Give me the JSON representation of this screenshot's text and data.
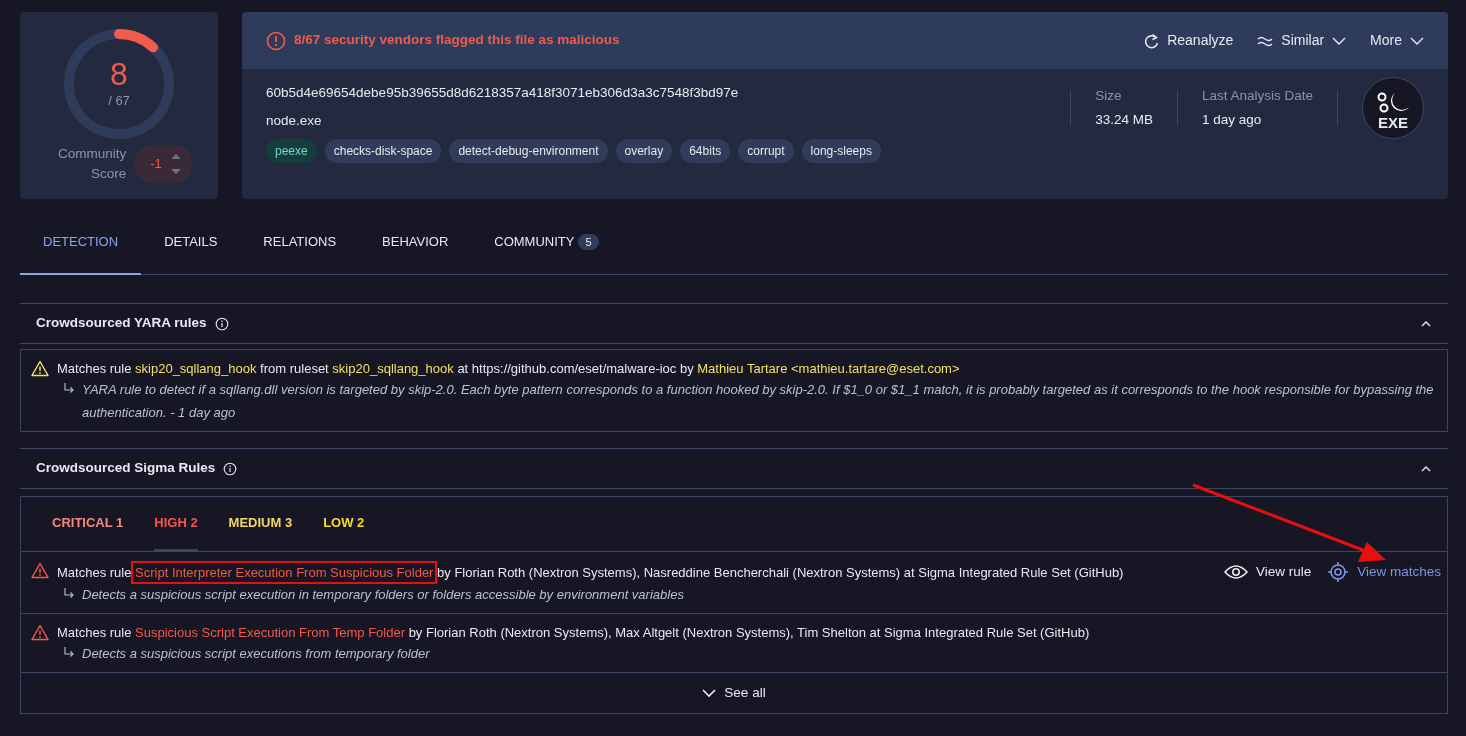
{
  "score": {
    "detections": "8",
    "total": "/ 67",
    "level": 0.119,
    "community_label": "Community Score",
    "community_value": "-1"
  },
  "alert": "8/67 security vendors flagged this file as malicious",
  "actions": [
    {
      "label": "Reanalyze",
      "kind": "reload"
    },
    {
      "label": "Similar",
      "kind": "similar"
    },
    {
      "label": "More",
      "kind": "more"
    }
  ],
  "file": {
    "hash": "60b5d4e69654debe95b39655d8d6218357a418f3071eb306d3a3c7548f3bd97e",
    "name": "node.exe",
    "tags": [
      {
        "label": "peexe",
        "selected": true
      },
      {
        "label": "checks-disk-space",
        "selected": false
      },
      {
        "label": "detect-debug-environment",
        "selected": false
      },
      {
        "label": "overlay",
        "selected": false
      },
      {
        "label": "64bits",
        "selected": false
      },
      {
        "label": "corrupt",
        "selected": false
      },
      {
        "label": "long-sleeps",
        "selected": false
      }
    ],
    "stats": [
      {
        "label": "Size",
        "value": "33.24 MB"
      },
      {
        "label": "Last Analysis Date",
        "value": "1 day ago"
      }
    ],
    "type_badge": "EXE"
  },
  "tabs": [
    {
      "label": "DETECTION",
      "selected": true
    },
    {
      "label": "DETAILS",
      "selected": false
    },
    {
      "label": "RELATIONS",
      "selected": false
    },
    {
      "label": "BEHAVIOR",
      "selected": false
    },
    {
      "label": "COMMUNITY",
      "selected": false,
      "count": "5"
    }
  ],
  "yara": {
    "title": "Crowdsourced YARA rules",
    "expanded": true,
    "matches": [
      {
        "kind": "warning",
        "parts": [
          {
            "text": "Matches rule "
          },
          {
            "text": "skip20_sqllang_hook",
            "kind": "link"
          },
          {
            "text": " from ruleset "
          },
          {
            "text": "skip20_sqllang_hook",
            "kind": "link"
          },
          {
            "text": " at https://github.com/eset/malware-ioc by "
          },
          {
            "text": "Mathieu Tartare <mathieu.tartare@eset.com>",
            "kind": "link"
          }
        ],
        "description": "YARA rule to detect if a sqllang.dll version is targeted by skip-2.0. Each byte pattern corresponds to a function hooked by skip-2.0. If $1_0 or $1_1 match, it is probably targeted as it corresponds to the hook responsible for bypassing the authentication. - 1 day ago"
      }
    ]
  },
  "sigma": {
    "title": "Crowdsourced Sigma Rules",
    "expanded": true,
    "filters": [
      {
        "label": "CRITICAL 1",
        "color": "#f28b7d",
        "selected": false
      },
      {
        "label": "HIGH 2",
        "color": "#f5574a",
        "selected": true
      },
      {
        "label": "MEDIUM 3",
        "color": "#f2d864",
        "selected": false
      },
      {
        "label": "LOW 2",
        "color": "#f5dc2a",
        "selected": false
      }
    ],
    "matches": [
      {
        "kind": "danger",
        "parts": [
          {
            "text": "Matches rule "
          },
          {
            "text": "Script Interpreter Execution From Suspicious Folder",
            "kind": "rule"
          },
          {
            "text": " by Florian Roth (Nextron Systems), Nasreddine Bencherchali (Nextron Systems) at Sigma Integrated Rule Set (GitHub)"
          }
        ],
        "description": "Detects a suspicious script execution in temporary folders or folders accessible by environment variables",
        "actions": [
          "View rule",
          "View matches"
        ],
        "highlighted": true
      },
      {
        "kind": "danger",
        "parts": [
          {
            "text": "Matches rule "
          },
          {
            "text": "Suspicious Script Execution From Temp Folder",
            "kind": "rule"
          },
          {
            "text": " by Florian Roth (Nextron Systems), Max Altgelt (Nextron Systems), Tim Shelton at Sigma Integrated Rule Set (GitHub)"
          }
        ],
        "description": "Detects a suspicious script executions from temporary folder",
        "highlighted": false
      }
    ],
    "see_all": "See all"
  },
  "annotations": [
    {
      "kind": "arrow"
    }
  ]
}
